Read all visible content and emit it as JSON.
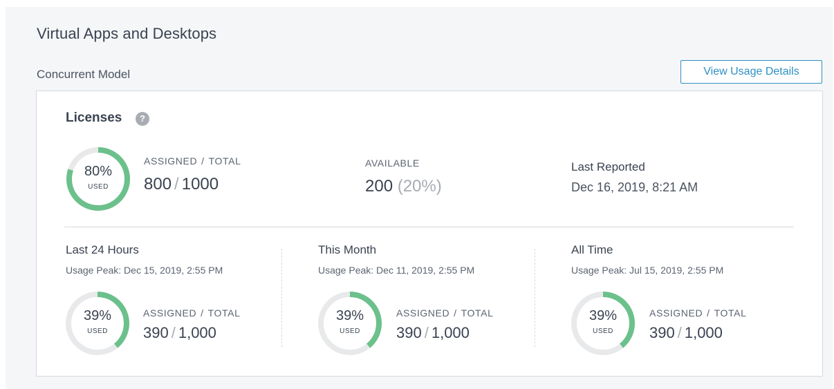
{
  "header": {
    "title": "Virtual Apps and Desktops",
    "model": "Concurrent Model",
    "usage_button": "View Usage Details"
  },
  "licenses": {
    "title": "Licenses",
    "help_icon": "?",
    "summary": {
      "percent_used": 80,
      "percent_label": "80%",
      "used_label": "USED",
      "assigned_label": "ASSIGNED",
      "total_label": "TOTAL",
      "separator": "/",
      "assigned": "800",
      "total": "1000"
    },
    "available": {
      "label": "AVAILABLE",
      "value": "200",
      "percent": "(20%)"
    },
    "last_reported": {
      "label": "Last Reported",
      "value": "Dec 16, 2019, 8:21 AM"
    }
  },
  "periods": [
    {
      "title": "Last 24 Hours",
      "peak": "Usage Peak: Dec 15, 2019, 2:55 PM",
      "percent_used": 39,
      "percent_label": "39%",
      "used_label": "USED",
      "assigned_label": "ASSIGNED",
      "total_label": "TOTAL",
      "separator": "/",
      "assigned": "390",
      "total": "1,000"
    },
    {
      "title": "This Month",
      "peak": "Usage Peak: Dec 11, 2019, 2:55 PM",
      "percent_used": 39,
      "percent_label": "39%",
      "used_label": "USED",
      "assigned_label": "ASSIGNED",
      "total_label": "TOTAL",
      "separator": "/",
      "assigned": "390",
      "total": "1,000"
    },
    {
      "title": "All Time",
      "peak": "Usage Peak: Jul 15, 2019, 2:55 PM",
      "percent_used": 39,
      "percent_label": "39%",
      "used_label": "USED",
      "assigned_label": "ASSIGNED",
      "total_label": "TOTAL",
      "separator": "/",
      "assigned": "390",
      "total": "1,000"
    }
  ],
  "colors": {
    "ring_fill": "#6cc08b",
    "ring_track": "#e8e9eb",
    "accent": "#2f8fc4"
  }
}
